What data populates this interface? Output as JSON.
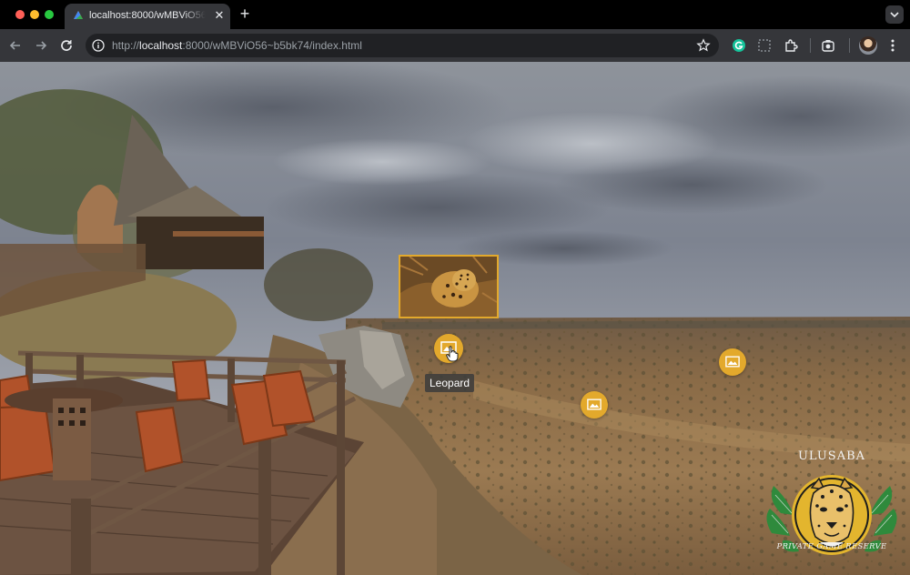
{
  "browser": {
    "tab_title": "localhost:8000/wMBViO56~b5bk74/index.html",
    "tab_close": "✕",
    "new_tab": "+",
    "url_scheme": "http://",
    "url_host": "localhost",
    "url_rest": ":8000/wMBViO56~b5bk74/index.html"
  },
  "tour": {
    "hotspots": [
      {
        "label": "Leopard",
        "icon": "image-icon"
      },
      {
        "icon": "image-icon"
      },
      {
        "icon": "image-icon"
      }
    ],
    "tooltip": "Leopard",
    "accent_color": "#e3a92c"
  },
  "logo": {
    "name": "ULUSABA",
    "tagline": "PRIVATE GAME RESERVE"
  }
}
